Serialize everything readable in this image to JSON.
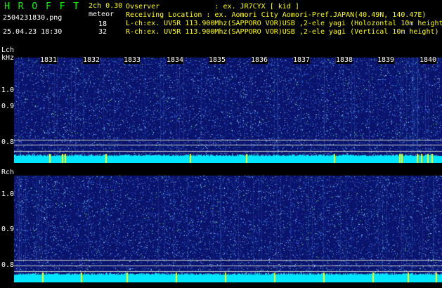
{
  "header": {
    "app_title": "H R O F F T",
    "channels": "2ch 0.30",
    "meteor_label": "meteor",
    "filename": "2504231830.png",
    "datetime": "25.04.23 18:30",
    "lch_count": "18",
    "rch_count": "32",
    "observer_line": "Ovserver             : ex. JR7CYX [ kid ]",
    "location_line": "Receiving Location : ex. Aomori City Aomori-Pref.JAPAN(40.49N, 140.47E)",
    "lch_line": "L-ch:ex. UV5R 113.900Mhz(SAPPORO VOR)USB ,2-ele yagi (Holozontal 10m height",
    "rch_line": "R-ch:ex. UV5R 113.900Mhz(SAPPORO VOR)USB ,2-ele yagi (Vertical 10m height)"
  },
  "lch": {
    "label": "Lch",
    "unit": "kHz",
    "y_ticks": [
      "1.0",
      "0.9",
      "0.8"
    ]
  },
  "rch": {
    "label": "Rch",
    "y_ticks": [
      "1.0",
      "0.9",
      "0.8"
    ]
  },
  "time_ticks": [
    "1831",
    "1832",
    "1833",
    "1834",
    "1835",
    "1836",
    "1837",
    "1838",
    "1839",
    "1840"
  ],
  "colors": {
    "title_green": "#00ff00",
    "text_yellow": "#ffff00",
    "text_white": "#ffffff",
    "spectro_bg": "#0a1a6e",
    "noise_band": "#00e6ff",
    "meteor_mark": "#ffff00"
  }
}
